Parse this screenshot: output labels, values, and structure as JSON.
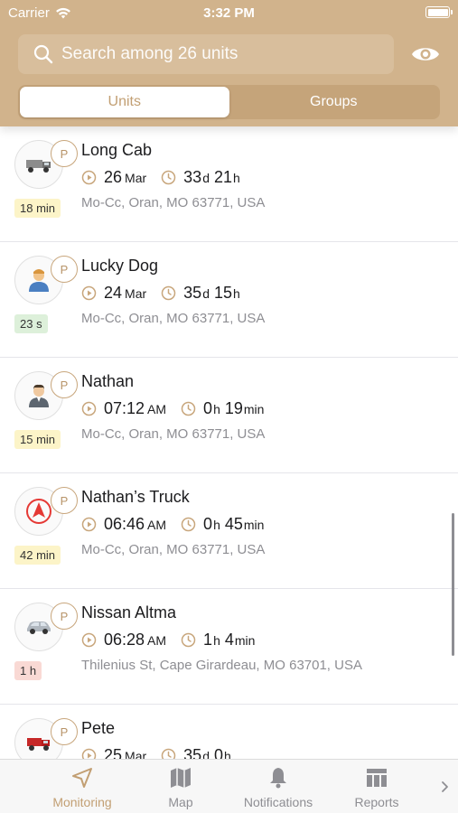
{
  "status_bar": {
    "carrier": "Carrier",
    "time": "3:32 PM"
  },
  "search": {
    "placeholder": "Search among 26 units"
  },
  "segments": [
    {
      "label": "Units",
      "active": true
    },
    {
      "label": "Groups",
      "active": false
    }
  ],
  "units": [
    {
      "name": "Long Cab",
      "icon": "truck-icon",
      "parking_badge": "P",
      "age": "18 min",
      "age_color": "yellow",
      "time_main": "26",
      "time_small": "Mar",
      "dur_a": "33",
      "dur_a_unit": "d",
      "dur_b": "21",
      "dur_b_unit": "h",
      "address": "Mo-Cc, Oran, MO 63771, USA"
    },
    {
      "name": "Lucky Dog",
      "icon": "person-icon",
      "parking_badge": "P",
      "age": "23 s",
      "age_color": "green",
      "time_main": "24",
      "time_small": "Mar",
      "dur_a": "35",
      "dur_a_unit": "d",
      "dur_b": "15",
      "dur_b_unit": "h",
      "address": "Mo-Cc, Oran, MO 63771, USA"
    },
    {
      "name": "Nathan",
      "icon": "man-icon",
      "parking_badge": "P",
      "age": "15 min",
      "age_color": "yellow",
      "time_main": "07:12",
      "time_small": "AM",
      "dur_a": "0",
      "dur_a_unit": "h",
      "dur_b": "19",
      "dur_b_unit": "min",
      "address": "Mo-Cc, Oran, MO 63771, USA"
    },
    {
      "name": "Nathan’s Truck",
      "icon": "direction-arrow-icon",
      "parking_badge": "P",
      "age": "42 min",
      "age_color": "yellow",
      "time_main": "06:46",
      "time_small": "AM",
      "dur_a": "0",
      "dur_a_unit": "h",
      "dur_b": "45",
      "dur_b_unit": "min",
      "address": "Mo-Cc, Oran, MO 63771, USA"
    },
    {
      "name": "Nissan Altma",
      "icon": "car-icon",
      "parking_badge": "P",
      "age": "1 h",
      "age_color": "red",
      "time_main": "06:28",
      "time_small": "AM",
      "dur_a": "1",
      "dur_a_unit": "h",
      "dur_b": "4",
      "dur_b_unit": "min",
      "address": "Thilenius St, Cape Girardeau, MO 63701, USA"
    },
    {
      "name": "Pete",
      "icon": "red-truck-icon",
      "parking_badge": "P",
      "age": "",
      "age_color": "yellow",
      "time_main": "25",
      "time_small": "Mar",
      "dur_a": "35",
      "dur_a_unit": "d",
      "dur_b": "0",
      "dur_b_unit": "h",
      "address": ""
    }
  ],
  "tabs": [
    {
      "label": "Monitoring",
      "icon": "navigation-arrow-icon",
      "active": true
    },
    {
      "label": "Map",
      "icon": "map-icon",
      "active": false
    },
    {
      "label": "Notifications",
      "icon": "bell-icon",
      "active": false
    },
    {
      "label": "Reports",
      "icon": "reports-table-icon",
      "active": false
    }
  ],
  "colors": {
    "accent": "#c29f73",
    "header": "#d1b38c",
    "search_bg": "#d8be9c",
    "segment_bg": "#c5a47a"
  }
}
